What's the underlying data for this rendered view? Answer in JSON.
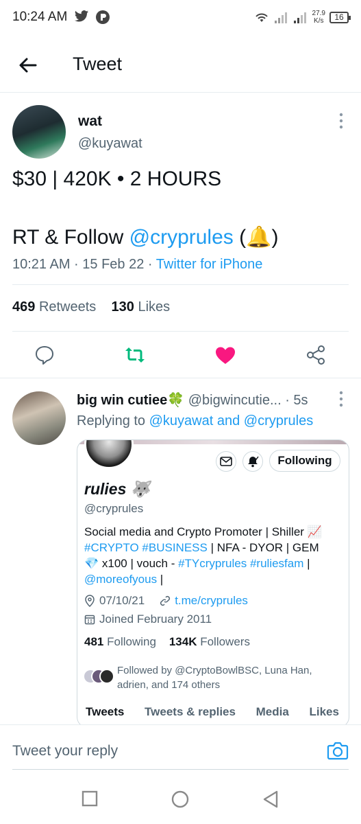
{
  "status_bar": {
    "time": "10:24 AM",
    "net_speed_value": "27.9",
    "net_speed_unit": "K/s",
    "battery": "16"
  },
  "header": {
    "title": "Tweet"
  },
  "main_tweet": {
    "name": "wat",
    "handle": "@kuyawat",
    "line1": "$30 | 420K • 2 HOURS",
    "line2_prefix": "RT & Follow ",
    "line2_mention": "@cryprules",
    "line2_open": " (",
    "line2_emoji": "🔔",
    "line2_close": ")",
    "timestamp": "10:21 AM · 15 Feb 22 · ",
    "source": "Twitter for iPhone",
    "retweets_count": "469",
    "retweets_label": "Retweets",
    "likes_count": "130",
    "likes_label": "Likes"
  },
  "reply": {
    "name": "big win cutiee🍀",
    "handle": "@bigwincutie...",
    "time": "· 5s",
    "replying_prefix": "Replying to ",
    "replying_to": "@kuyawat and @cryprules"
  },
  "profile_card": {
    "name": "rulies",
    "name_emoji": "🐺",
    "handle": "@cryprules",
    "follow_button": "Following",
    "bio_1": "Social media and Crypto Promoter | Shiller 📈",
    "bio_hash1": "#CRYPTO",
    "bio_hash2": "#BUSINESS",
    "bio_2": " | NFA - DYOR | GEM",
    "bio_3_emoji": "💎",
    "bio_3": " x100 | vouch - ",
    "bio_hash3": "#TYcryprules",
    "bio_hash4": "#ruliesfam",
    "bio_3_end": " |",
    "bio_mention": "@moreofyous",
    "bio_4_end": " |",
    "birthday": "07/10/21",
    "link": "t.me/cryprules",
    "joined": "Joined February 2011",
    "following_count": "481",
    "following_label": "Following",
    "followers_count": "134K",
    "followers_label": "Followers",
    "followed_by": "Followed by @CryptoBowlBSC, Luna Han, adrien, and 174 others",
    "tabs": [
      "Tweets",
      "Tweets & replies",
      "Media",
      "Likes"
    ]
  },
  "composer": {
    "placeholder": "Tweet your reply"
  },
  "colors": {
    "accent": "#1d9bf0",
    "retweet": "#00ba7c",
    "like": "#f91880"
  }
}
